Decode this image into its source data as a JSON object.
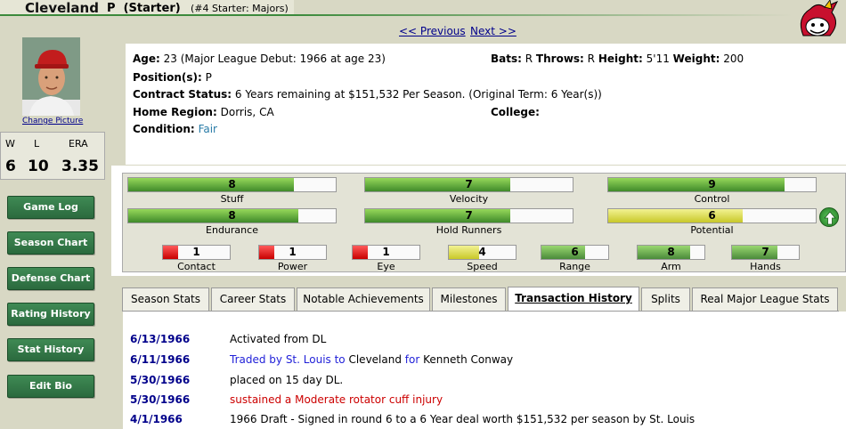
{
  "header": {
    "team": "Cleveland",
    "position": "P",
    "role": "(Starter)",
    "designation": "(#4 Starter: Majors)"
  },
  "nav": {
    "previous": "<< Previous",
    "next": "Next >>"
  },
  "sidebar": {
    "change_picture": "Change Picture",
    "stats": {
      "headers": [
        "W",
        "L",
        "ERA"
      ],
      "values": [
        "6",
        "10",
        "3.35"
      ]
    },
    "buttons": [
      "Game Log",
      "Season Chart",
      "Defense Chart",
      "Rating History",
      "Stat History",
      "Edit Bio"
    ]
  },
  "info": {
    "age_label": "Age:",
    "age_value": "23  (Major League Debut: 1966 at age 23)",
    "bats_label": "Bats:",
    "bats_value": "R",
    "throws_label": "Throws:",
    "throws_value": "R",
    "height_label": "Height:",
    "height_value": "5'11",
    "weight_label": "Weight:",
    "weight_value": "200",
    "positions_label": "Position(s):",
    "positions_value": "P",
    "contract_label": "Contract Status:",
    "contract_value": "6 Years remaining at $151,532 Per Season. (Original Term: 6 Year(s))",
    "region_label": "Home Region:",
    "region_value": "Dorris, CA",
    "college_label": "College:",
    "college_value": "",
    "condition_label": "Condition:",
    "condition_value": "Fair"
  },
  "ratings": {
    "row1": [
      {
        "label": "Stuff",
        "value": "8",
        "fill": 0.8,
        "color": "g"
      },
      {
        "label": "Velocity",
        "value": "7",
        "fill": 0.7,
        "color": "g"
      },
      {
        "label": "Control",
        "value": "9",
        "fill": 0.85,
        "color": "g"
      }
    ],
    "row2": [
      {
        "label": "Endurance",
        "value": "8",
        "fill": 0.82,
        "color": "g"
      },
      {
        "label": "Hold Runners",
        "value": "7",
        "fill": 0.7,
        "color": "g"
      },
      {
        "label": "Potential",
        "value": "6",
        "fill": 0.65,
        "color": "y"
      }
    ],
    "row3": [
      {
        "label": "Contact",
        "value": "1",
        "fill": 0.22,
        "color": "r"
      },
      {
        "label": "Power",
        "value": "1",
        "fill": 0.22,
        "color": "r"
      },
      {
        "label": "Eye",
        "value": "1",
        "fill": 0.22,
        "color": "r"
      },
      {
        "label": "Speed",
        "value": "4",
        "fill": 0.45,
        "color": "y"
      },
      {
        "label": "Range",
        "value": "6",
        "fill": 0.65,
        "color": "lg"
      },
      {
        "label": "Arm",
        "value": "8",
        "fill": 0.78,
        "color": "lg"
      },
      {
        "label": "Hands",
        "value": "7",
        "fill": 0.68,
        "color": "lg"
      }
    ]
  },
  "tabs": [
    {
      "label": "Season Stats",
      "active": false
    },
    {
      "label": "Career Stats",
      "active": false
    },
    {
      "label": "Notable Achievements",
      "active": false
    },
    {
      "label": "Milestones",
      "active": false
    },
    {
      "label": "Transaction History",
      "active": true
    },
    {
      "label": "Splits",
      "active": false
    },
    {
      "label": "Real Major League Stats",
      "active": false
    }
  ],
  "transactions": [
    {
      "date": "6/13/1966",
      "text": "Activated from DL"
    },
    {
      "date": "6/11/1966",
      "traded_by": "Traded by St. Louis to",
      "team": "Cleveland",
      "for": "for",
      "player": "Kenneth Conway"
    },
    {
      "date": "5/30/1966",
      "text": "placed on 15 day DL."
    },
    {
      "date": "5/30/1966",
      "injury": "sustained a Moderate rotator cuff injury"
    },
    {
      "date": "4/1/1966",
      "text": "1966 Draft - Signed in round 6 to a 6 Year deal worth $151,532 per season by St. Louis"
    }
  ],
  "colors": {
    "accent": "#3c8a3c",
    "link": "#00008b",
    "button": "#2b6a3e"
  }
}
